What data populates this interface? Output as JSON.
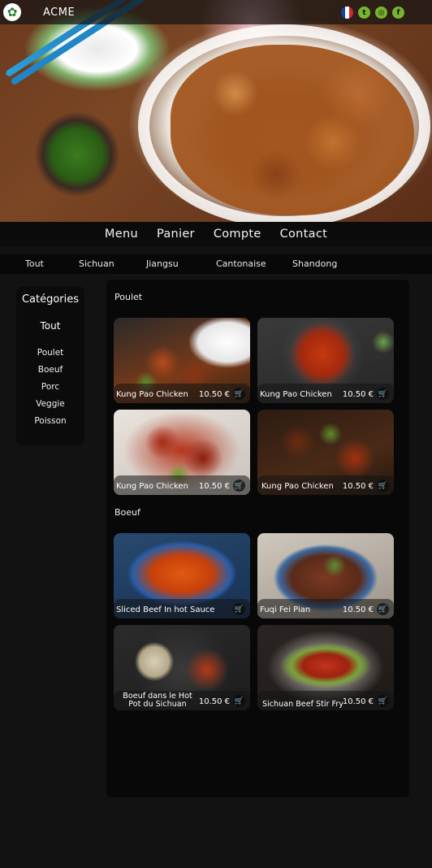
{
  "brand": {
    "name": "ACME",
    "logo_icon": "flower-icon"
  },
  "top_icons": [
    {
      "name": "french-flag-icon"
    },
    {
      "name": "twitter-icon",
      "glyph": "t"
    },
    {
      "name": "instagram-icon",
      "glyph": "◎"
    },
    {
      "name": "facebook-icon",
      "glyph": "f"
    }
  ],
  "main_nav": [
    "Menu",
    "Panier",
    "Compte",
    "Contact"
  ],
  "sub_nav": [
    "Tout",
    "Sichuan",
    "Jiangsu",
    "Cantonaise",
    "Shandong"
  ],
  "sidebar": {
    "title": "Catégories",
    "all_label": "Tout",
    "items": [
      "Poulet",
      "Boeuf",
      "Porc",
      "Veggie",
      "Poisson"
    ]
  },
  "sections": [
    {
      "title": "Poulet",
      "items": [
        {
          "name": "Kung Pao Chicken",
          "price": "10.50 €"
        },
        {
          "name": "Kung Pao Chicken",
          "price": "10.50 €"
        },
        {
          "name": "Kung Pao Chicken",
          "price": "10.50 €"
        },
        {
          "name": "Kung Pao Chicken",
          "price": "10.50 €"
        }
      ]
    },
    {
      "title": "Boeuf",
      "items": [
        {
          "name": "Sliced Beef In hot Sauce",
          "price": ""
        },
        {
          "name": "Fuqi Fei Pian",
          "price": "10.50 €"
        },
        {
          "name": "Boeuf dans le Hot Pot du Sichuan",
          "price": "10.50 €"
        },
        {
          "name": "Sichuan Beef Stir Fry",
          "price": "10.50 €"
        }
      ]
    }
  ],
  "colors": {
    "background": "#121212",
    "panel": "#080808",
    "social_icon": "#75b52f"
  }
}
